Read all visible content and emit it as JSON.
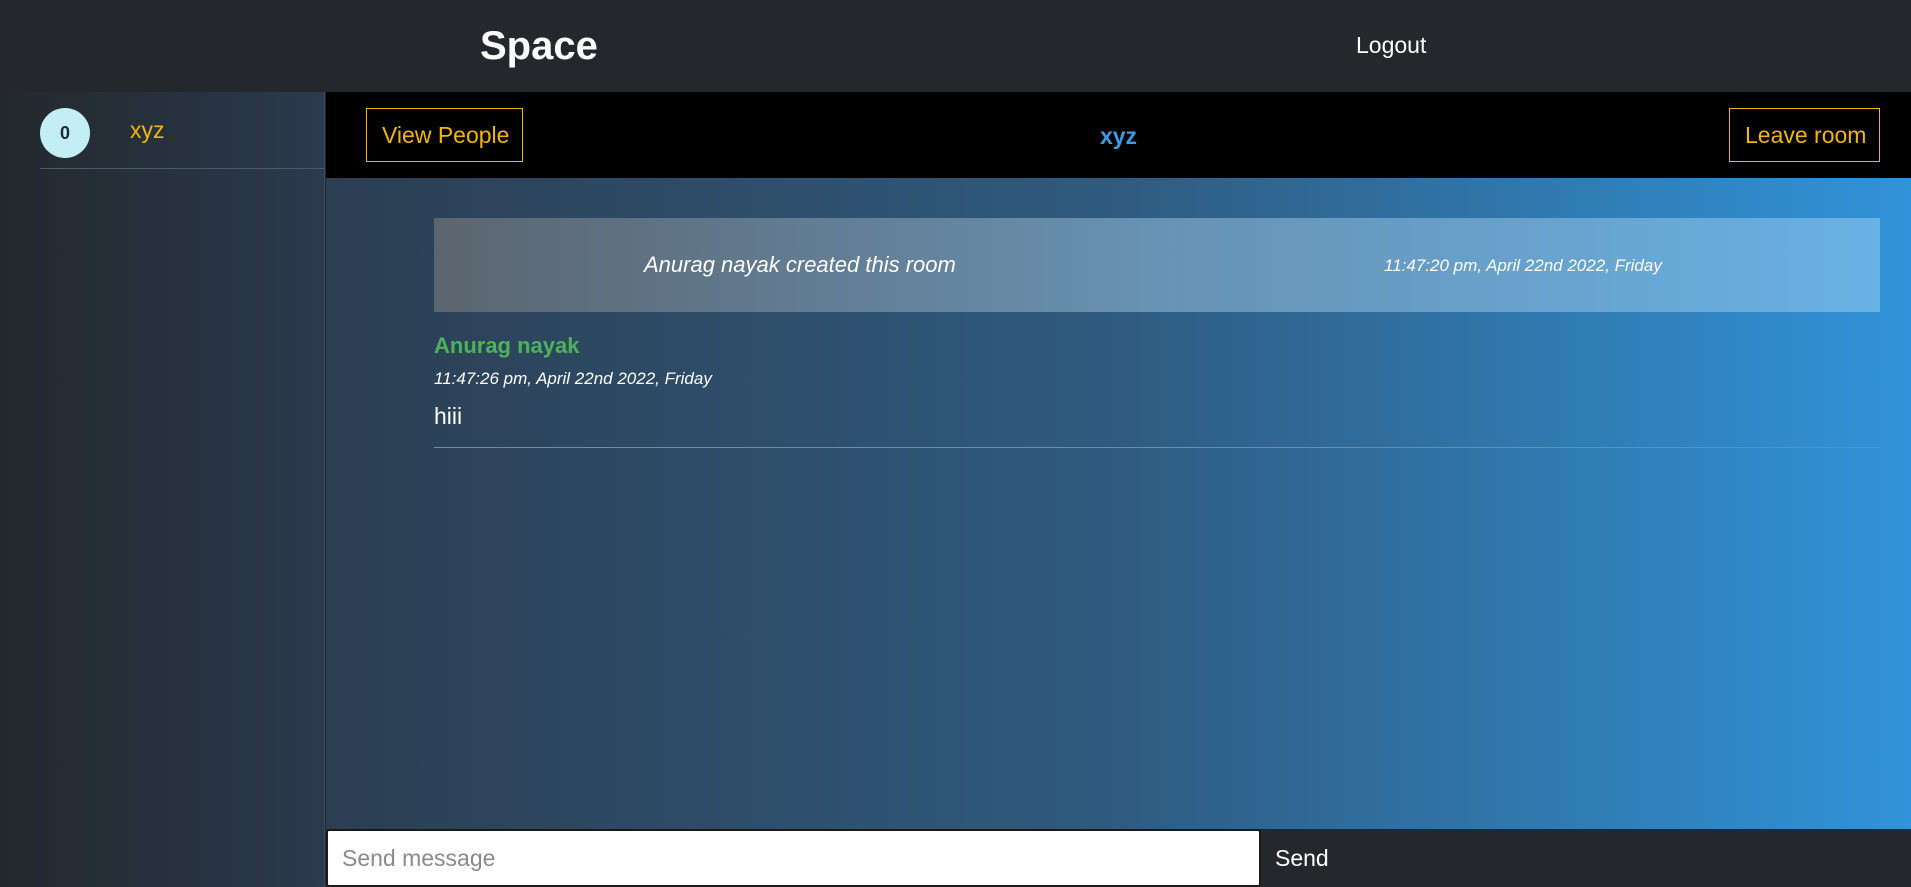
{
  "navbar": {
    "brand": "Space",
    "logout_label": "Logout"
  },
  "sidebar": {
    "rooms": [
      {
        "count": "0",
        "name": "xyz"
      }
    ]
  },
  "room": {
    "title": "xyz",
    "view_people_label": "View People",
    "leave_room_label": "Leave room"
  },
  "system_message": {
    "text": "Anurag nayak created this room",
    "time": "11:47:20 pm, April 22nd 2022, Friday"
  },
  "messages": [
    {
      "author": "Anurag nayak",
      "time": "11:47:26 pm, April 22nd 2022, Friday",
      "text": "hiii"
    }
  ],
  "composer": {
    "placeholder": "Send message",
    "value": "",
    "send_label": "Send"
  },
  "colors": {
    "accent": "#f2b705",
    "author": "#4cb25c",
    "room_title": "#3d9be4",
    "nav_bg": "#24282d"
  }
}
